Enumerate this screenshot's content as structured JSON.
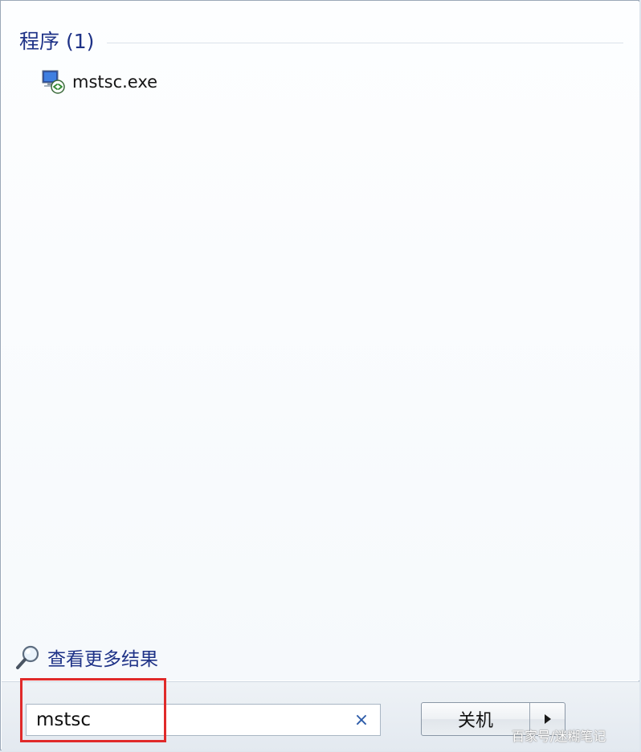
{
  "results": {
    "section_title": "程序 (1)",
    "programs": [
      {
        "label": "mstsc.exe",
        "icon": "remote-desktop-icon"
      }
    ]
  },
  "see_more": {
    "label": "查看更多结果",
    "icon": "magnifier-icon"
  },
  "search": {
    "value": "mstsc",
    "clear_icon": "×"
  },
  "shutdown": {
    "label": "关机",
    "arrow_icon": "triangle-right-icon"
  },
  "watermark": {
    "text": "百家号/迷糊笔记"
  },
  "colors": {
    "link_blue": "#1e3287",
    "highlight_red": "#e02a2a"
  }
}
